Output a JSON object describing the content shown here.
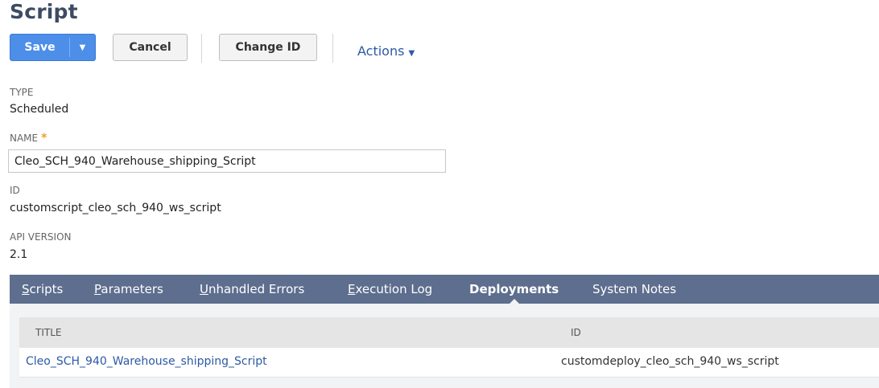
{
  "page": {
    "title": "Script"
  },
  "toolbar": {
    "save_label": "Save",
    "cancel_label": "Cancel",
    "change_id_label": "Change ID",
    "actions_label": "Actions"
  },
  "fields": {
    "type": {
      "label": "TYPE",
      "value": "Scheduled"
    },
    "name": {
      "label": "NAME",
      "required_mark": "*",
      "value": "Cleo_SCH_940_Warehouse_shipping_Script"
    },
    "id": {
      "label": "ID",
      "value": "customscript_cleo_sch_940_ws_script"
    },
    "api_version": {
      "label": "API VERSION",
      "value": "2.1"
    }
  },
  "tabs": [
    {
      "first": "S",
      "rest": "cripts"
    },
    {
      "first": "P",
      "rest": "arameters"
    },
    {
      "first": "U",
      "rest": "nhandled Errors"
    },
    {
      "first": "E",
      "rest": "xecution Log"
    },
    {
      "label": "Deployments",
      "active": true
    },
    {
      "label": "System Notes"
    }
  ],
  "deployments": {
    "columns": [
      "TITLE",
      "ID"
    ],
    "rows": [
      {
        "title": "Cleo_SCH_940_Warehouse_shipping_Script",
        "id": "customdeploy_cleo_sch_940_ws_script"
      }
    ]
  },
  "colors": {
    "primary_button": "#4d8ee8",
    "tab_bar": "#5d6e8e",
    "link": "#2b5aa5",
    "required": "#f0a020"
  }
}
